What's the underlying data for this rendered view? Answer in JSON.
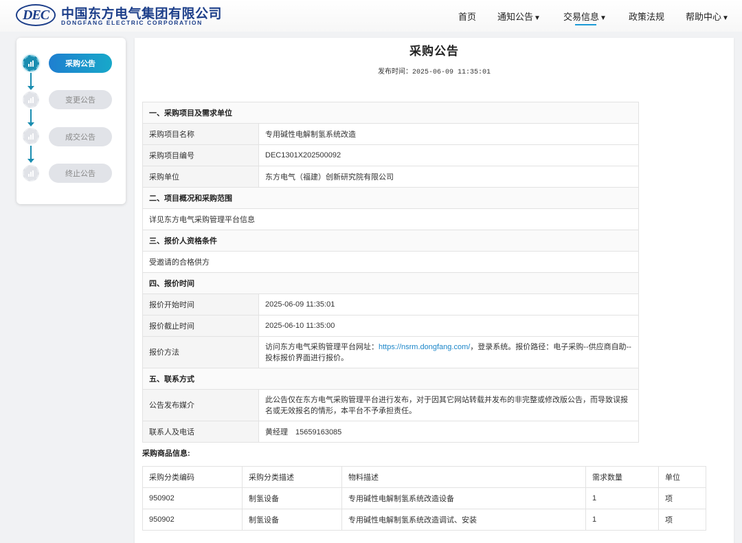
{
  "header": {
    "logo_mark": "DEC",
    "logo_cn": "中国东方电气集团有限公司",
    "logo_en": "DONGFANG ELECTRIC CORPORATION",
    "nav": [
      {
        "label": "首页",
        "caret": ""
      },
      {
        "label": "通知公告",
        "caret": "▼"
      },
      {
        "label": "交易信息",
        "caret": "▼",
        "active": true
      },
      {
        "label": "政策法规",
        "caret": ""
      },
      {
        "label": "帮助中心",
        "caret": "▼"
      }
    ],
    "accent_color": "#1b9ad6"
  },
  "sidebar": {
    "steps": [
      {
        "label": "采购公告",
        "active": true
      },
      {
        "label": "变更公告",
        "active": false
      },
      {
        "label": "成交公告",
        "active": false
      },
      {
        "label": "终止公告",
        "active": false
      }
    ]
  },
  "main": {
    "title": "采购公告",
    "publish_label": "发布时间：",
    "publish_time": "2025-06-09 11:35:01",
    "sections": {
      "s1": "一、采购项目及需求单位",
      "s2": "二、项目概况和采购范围",
      "s3": "三、报价人资格条件",
      "s4": "四、报价时间",
      "s5": "五、联系方式"
    },
    "rows": {
      "project_name_label": "采购项目名称",
      "project_name": "专用碱性电解制氢系统改造",
      "project_no_label": "采购项目编号",
      "project_no": "DEC1301X202500092",
      "buyer_label": "采购单位",
      "buyer": "东方电气（福建）创新研究院有限公司",
      "scope": "详见东方电气采购管理平台信息",
      "qualification": "受邀请的合格供方",
      "start_label": "报价开始时间",
      "start_time": "2025-06-09 11:35:01",
      "end_label": "报价截止时间",
      "end_time": "2025-06-10 11:35:00",
      "method_label": "报价方法",
      "method_prefix": "访问东方电气采购管理平台网址：",
      "method_url": "https://nsrm.dongfang.com/",
      "method_suffix": "，登录系统。报价路径：电子采购--供应商自助--投标报价界面进行报价。",
      "media_label": "公告发布媒介",
      "media": "此公告仅在东方电气采购管理平台进行发布，对于因其它网站转载并发布的非完整或修改版公告，而导致误报名或无效报名的情形，本平台不予承担责任。",
      "contact_label": "联系人及电话",
      "contact": "黄经理　15659163085"
    },
    "goods_title": "采购商品信息:",
    "goods_headers": [
      "采购分类编码",
      "采购分类描述",
      "物料描述",
      "需求数量",
      "单位"
    ],
    "goods_rows": [
      [
        "950902",
        "制氢设备",
        "专用碱性电解制氢系统改造设备",
        "1",
        "项"
      ],
      [
        "950902",
        "制氢设备",
        "专用碱性电解制氢系统改造调试、安装",
        "1",
        "项"
      ]
    ]
  }
}
